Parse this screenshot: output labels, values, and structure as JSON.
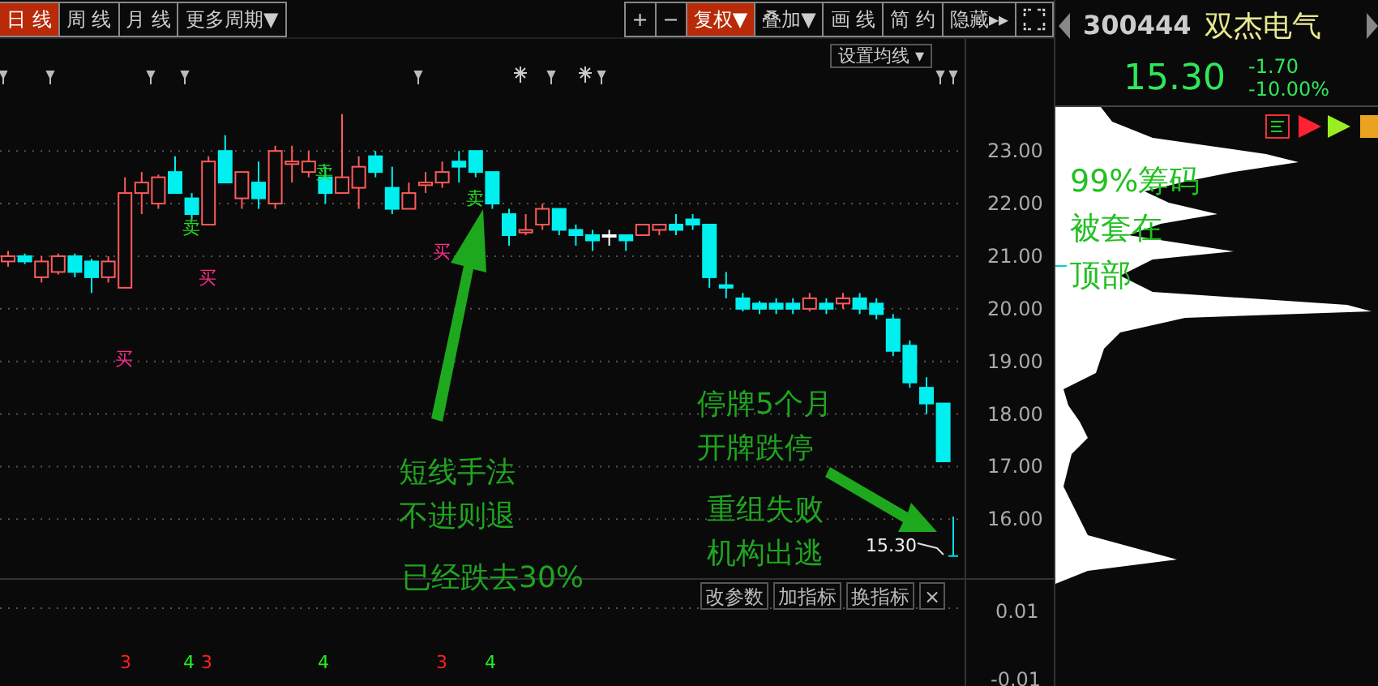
{
  "toolbar": {
    "periods": [
      {
        "label": "日 线",
        "selected": true
      },
      {
        "label": "周 线",
        "selected": false
      },
      {
        "label": "月 线",
        "selected": false
      },
      {
        "label": "更多周期▼",
        "selected": false
      }
    ],
    "tools": [
      {
        "label": "+",
        "highlighted": false
      },
      {
        "label": "−",
        "highlighted": false
      },
      {
        "label": "复权▼",
        "highlighted": true
      },
      {
        "label": "叠加▼",
        "highlighted": false
      },
      {
        "label": "画 线",
        "highlighted": false
      },
      {
        "label": "简 约",
        "highlighted": false
      },
      {
        "label": "隐藏▸▸",
        "highlighted": false
      }
    ]
  },
  "ma_dropdown": "设置均线 ▾",
  "chart_data": {
    "type": "candlestick",
    "ylim": [
      12.83,
      25.13
    ],
    "yticks": [
      {
        "value": 23,
        "label": "23.00"
      },
      {
        "value": 22,
        "label": "22.00"
      },
      {
        "value": 21,
        "label": "21.00"
      },
      {
        "value": 20,
        "label": "20.00"
      },
      {
        "value": 19,
        "label": "19.00"
      },
      {
        "value": 18,
        "label": "18.00"
      },
      {
        "value": 17,
        "label": "17.00"
      },
      {
        "value": 16,
        "label": "16.00"
      }
    ],
    "ohlc": [
      [
        20.9,
        21.1,
        20.8,
        21.0
      ],
      [
        21.0,
        21.05,
        20.85,
        20.9
      ],
      [
        20.6,
        21.0,
        20.5,
        20.9
      ],
      [
        20.7,
        21.05,
        20.65,
        21.0
      ],
      [
        21.0,
        21.05,
        20.6,
        20.7
      ],
      [
        20.9,
        20.95,
        20.3,
        20.6
      ],
      [
        20.6,
        21.0,
        20.5,
        20.9
      ],
      [
        20.4,
        22.5,
        20.4,
        22.2
      ],
      [
        22.2,
        22.6,
        21.8,
        22.4
      ],
      [
        22.0,
        22.55,
        21.9,
        22.5
      ],
      [
        22.6,
        22.9,
        22.2,
        22.2
      ],
      [
        22.1,
        22.2,
        21.7,
        21.8
      ],
      [
        21.6,
        22.9,
        21.6,
        22.8
      ],
      [
        23.0,
        23.3,
        22.4,
        22.4
      ],
      [
        22.1,
        22.6,
        21.9,
        22.6
      ],
      [
        22.4,
        22.8,
        21.9,
        22.1
      ],
      [
        22.0,
        23.1,
        21.9,
        23.0
      ],
      [
        22.75,
        23.1,
        22.4,
        22.8
      ],
      [
        22.6,
        23.0,
        22.5,
        22.8
      ],
      [
        22.5,
        22.7,
        22.0,
        22.2
      ],
      [
        22.2,
        23.7,
        22.2,
        22.5
      ],
      [
        22.3,
        22.9,
        21.9,
        22.7
      ],
      [
        22.9,
        23.0,
        22.5,
        22.6
      ],
      [
        22.3,
        22.7,
        21.8,
        21.9
      ],
      [
        21.9,
        22.4,
        21.9,
        22.2
      ],
      [
        22.35,
        22.6,
        22.2,
        22.4
      ],
      [
        22.4,
        22.8,
        22.3,
        22.6
      ],
      [
        22.8,
        23.0,
        22.4,
        22.7
      ],
      [
        23.0,
        23.0,
        22.5,
        22.6
      ],
      [
        22.6,
        22.6,
        21.9,
        22.0
      ],
      [
        21.8,
        21.9,
        21.2,
        21.4
      ],
      [
        21.45,
        21.8,
        21.4,
        21.5
      ],
      [
        21.6,
        22.0,
        21.5,
        21.9
      ],
      [
        21.9,
        21.9,
        21.4,
        21.5
      ],
      [
        21.5,
        21.6,
        21.2,
        21.4
      ],
      [
        21.4,
        21.5,
        21.1,
        21.3
      ],
      [
        21.4,
        21.5,
        21.2,
        21.4
      ],
      [
        21.4,
        21.4,
        21.1,
        21.3
      ],
      [
        21.4,
        21.6,
        21.4,
        21.6
      ],
      [
        21.5,
        21.6,
        21.4,
        21.6
      ],
      [
        21.6,
        21.8,
        21.4,
        21.5
      ],
      [
        21.7,
        21.8,
        21.5,
        21.6
      ],
      [
        21.6,
        21.6,
        20.4,
        20.6
      ],
      [
        20.45,
        20.7,
        20.2,
        20.4
      ],
      [
        20.2,
        20.3,
        19.95,
        20.0
      ],
      [
        20.1,
        20.15,
        19.9,
        20.0
      ],
      [
        20.1,
        20.2,
        19.9,
        20.0
      ],
      [
        20.1,
        20.2,
        19.9,
        20.0
      ],
      [
        20.0,
        20.3,
        19.95,
        20.2
      ],
      [
        20.1,
        20.2,
        19.9,
        20.0
      ],
      [
        20.1,
        20.3,
        20.0,
        20.2
      ],
      [
        20.2,
        20.3,
        19.9,
        20.0
      ],
      [
        20.1,
        20.2,
        19.8,
        19.9
      ],
      [
        19.8,
        19.9,
        19.1,
        19.2
      ],
      [
        19.3,
        19.4,
        18.5,
        18.6
      ],
      [
        18.5,
        18.7,
        18.0,
        18.2
      ],
      [
        18.2,
        18.2,
        17.1,
        17.1
      ]
    ]
  },
  "indicator_axis": [
    "0.01",
    "-0.01"
  ],
  "last_price_label": "15.30",
  "signals": [
    {
      "kind": "buy",
      "text": "买"
    },
    {
      "kind": "sell",
      "text": "卖"
    },
    {
      "kind": "buy",
      "text": "买"
    },
    {
      "kind": "sell",
      "text": "卖"
    },
    {
      "kind": "buy",
      "text": "买"
    },
    {
      "kind": "sell",
      "text": "卖"
    }
  ],
  "indicator_marks": [
    {
      "kind": "up",
      "text": "3"
    },
    {
      "kind": "down",
      "text": "4"
    },
    {
      "kind": "up",
      "text": "3"
    },
    {
      "kind": "down",
      "text": "4"
    },
    {
      "kind": "up",
      "text": "3"
    },
    {
      "kind": "down",
      "text": "4"
    }
  ],
  "annotations": [
    {
      "lines": [
        "短线手法",
        "不进则退"
      ]
    },
    {
      "lines": [
        "已经跌去30%"
      ]
    },
    {
      "lines": [
        "停牌5个月",
        "开牌跌停"
      ]
    },
    {
      "lines": [
        "重组失败",
        "机构出逃"
      ]
    }
  ],
  "indicator_buttons": [
    "改参数",
    "加指标",
    "换指标",
    "×"
  ],
  "quote": {
    "code": "300444",
    "name": "双杰电气",
    "price": "15.30",
    "change": "-1.70",
    "change_pct": "-10.00%"
  },
  "chip_note": [
    "99%筹码",
    "被套在",
    "顶部"
  ]
}
